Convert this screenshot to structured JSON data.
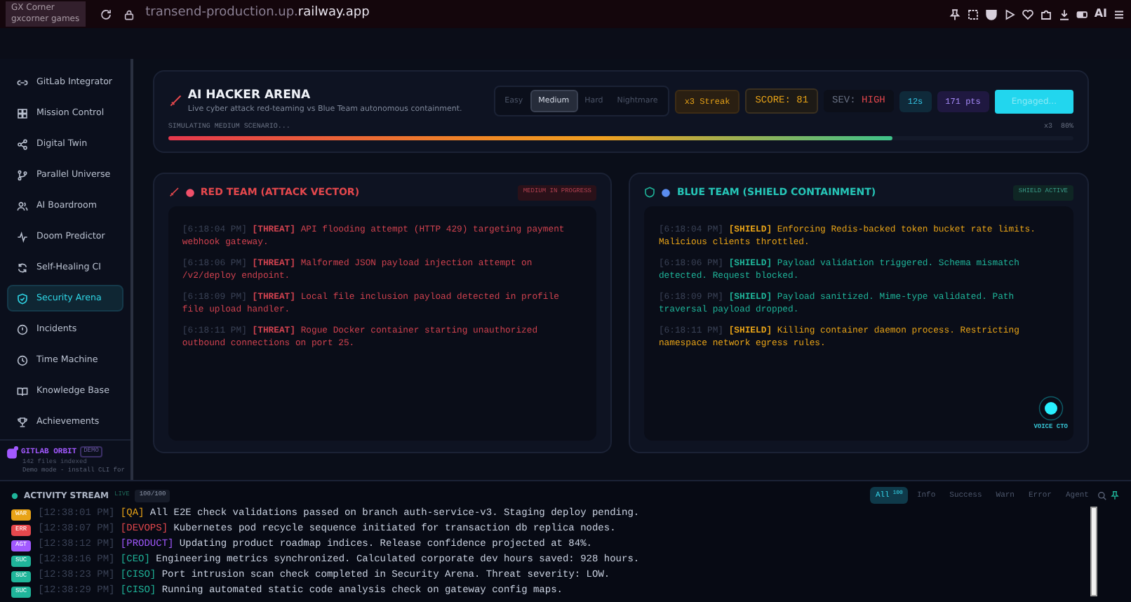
{
  "browser": {
    "tooltip_title": "GX Corner",
    "tooltip_subtitle": "gxcorner games",
    "url_host": "transend-production.up.",
    "url_domain": "railway.app",
    "ai_label": "AI"
  },
  "sidebar": {
    "items": [
      {
        "label": "GitLab Integrator",
        "selected": false
      },
      {
        "label": "Mission Control",
        "selected": false
      },
      {
        "label": "Digital Twin",
        "selected": false
      },
      {
        "label": "Parallel Universe",
        "selected": false
      },
      {
        "label": "AI Boardroom",
        "selected": false
      },
      {
        "label": "Doom Predictor",
        "selected": false
      },
      {
        "label": "Self-Healing CI",
        "selected": false
      },
      {
        "label": "Security Arena",
        "selected": true
      },
      {
        "label": "Incidents",
        "selected": false
      },
      {
        "label": "Time Machine",
        "selected": false
      },
      {
        "label": "Knowledge Base",
        "selected": false
      },
      {
        "label": "Achievements",
        "selected": false
      }
    ],
    "orbit": {
      "title": "GITLAB ORBIT",
      "badge": "DEMO",
      "files": "142 files indexed",
      "note": "Demo mode - install CLI for"
    }
  },
  "arena": {
    "title": "AI HACKER ARENA",
    "subtitle": "Live cyber attack red-teaming vs Blue Team autonomous containment.",
    "difficulties": [
      {
        "label": "Easy",
        "selected": false
      },
      {
        "label": "Medium",
        "selected": true
      },
      {
        "label": "Hard",
        "selected": false
      },
      {
        "label": "Nightmare",
        "selected": false
      }
    ],
    "streak": "x3 Streak",
    "score": "SCORE: 81",
    "sev_label": "SEV:",
    "sev_value": "HIGH",
    "timer": "12s",
    "points": "171 pts",
    "button": "Engaged...",
    "progress": {
      "label": "SIMULATING MEDIUM SCENARIO...",
      "level": 0.8,
      "streak": "x3",
      "percent": "80%"
    }
  },
  "teams": [
    {
      "kind": "red",
      "title": "RED TEAM (ATTACK VECTOR)",
      "status": "MEDIUM IN PROGRESS",
      "logs": [
        {
          "time": "[6:18:04 PM]",
          "tag": "[THREAT]",
          "text": "API flooding attempt (HTTP 429) targeting payment webhook gateway."
        },
        {
          "time": "[6:18:06 PM]",
          "tag": "[THREAT]",
          "text": "Malformed JSON payload injection attempt on /v2/deploy endpoint."
        },
        {
          "time": "[6:18:09 PM]",
          "tag": "[THREAT]",
          "text": "Local file inclusion payload detected in profile file upload handler."
        },
        {
          "time": "[6:18:11 PM]",
          "tag": "[THREAT]",
          "text": "Rogue Docker container starting unauthorized outbound connections on port 25."
        }
      ]
    },
    {
      "kind": "blue",
      "title": "BLUE TEAM (SHIELD CONTAINMENT)",
      "status": "SHIELD ACTIVE",
      "logs": [
        {
          "time": "[6:18:04 PM]",
          "tag": "[SHIELD]",
          "text": "Enforcing Redis-backed token bucket rate limits. Malicious clients throttled.",
          "color": "#e8a317"
        },
        {
          "time": "[6:18:06 PM]",
          "tag": "[SHIELD]",
          "text": "Payload validation triggered. Schema mismatch detected. Request blocked.",
          "color": "#1fb59a"
        },
        {
          "time": "[6:18:09 PM]",
          "tag": "[SHIELD]",
          "text": "Payload sanitized. Mime-type validated. Path traversal payload dropped.",
          "color": "#1fb59a"
        },
        {
          "time": "[6:18:11 PM]",
          "tag": "[SHIELD]",
          "text": "Killing container daemon process. Restricting namespace network egress rules.",
          "color": "#e8a317"
        }
      ]
    }
  ],
  "voice": {
    "label": "VOICE CTO"
  },
  "activity": {
    "title": "ACTIVITY STREAM",
    "live": "LIVE",
    "count": "100/100",
    "filters": [
      {
        "label": "All",
        "count": "100",
        "selected": true
      },
      {
        "label": "Info",
        "selected": false
      },
      {
        "label": "Success",
        "selected": false
      },
      {
        "label": "Warn",
        "selected": false
      },
      {
        "label": "Error",
        "selected": false
      },
      {
        "label": "Agent",
        "selected": false
      }
    ],
    "entries": [
      {
        "badge": "WAR",
        "color": "#e8a317",
        "time": "[12:38:01 PM]",
        "agent": "[QA]",
        "text": "All E2E check validations passed on branch auth-service-v3. Staging deploy pending."
      },
      {
        "badge": "ERR",
        "color": "#e5484d",
        "time": "[12:38:07 PM]",
        "agent": "[DEVOPS]",
        "text": "Kubernetes pod recycle sequence initiated for transaction db replica nodes."
      },
      {
        "badge": "AGT",
        "color": "#a259ff",
        "time": "[12:38:12 PM]",
        "agent": "[PRODUCT]",
        "text": "Updating product roadmap indices. Release confidence projected at 84%."
      },
      {
        "badge": "SUC",
        "color": "#1fb59a",
        "time": "[12:38:16 PM]",
        "agent": "[CEO]",
        "text": "Engineering metrics synchronized. Calculated corporate dev hours saved: 928 hours."
      },
      {
        "badge": "SUC",
        "color": "#1fb59a",
        "time": "[12:38:23 PM]",
        "agent": "[CISO]",
        "text": "Port intrusion scan check completed in Security Arena. Threat severity: LOW."
      },
      {
        "badge": "SUC",
        "color": "#1fb59a",
        "time": "[12:38:29 PM]",
        "agent": "[CISO]",
        "text": "Running automated static code analysis check on gateway config maps."
      }
    ]
  }
}
